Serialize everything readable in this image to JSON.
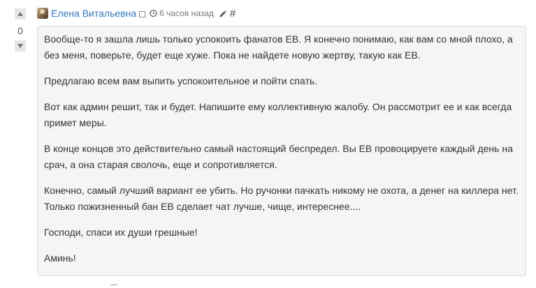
{
  "vote": {
    "count": "0"
  },
  "header": {
    "author": "Елена Витальевна",
    "time": "6 часов назад",
    "hash": "#"
  },
  "body": {
    "paragraphs": [
      "Вообще-то я зашла лишь только успокоить фанатов ЕВ. Я конечно понимаю, как вам со мной плохо, а без меня, поверьте, будет еще хуже. Пока не найдете новую жертву, такую как ЕВ.",
      "Предлагаю всем вам выпить успокоительное и пойти спать.",
      "Вот как админ решит, так и будет. Напишите ему коллективную жалобу. Он рассмотрит ее и как всегда примет меры.",
      "В конце концов это действительно самый настоящий беспредел. Вы ЕВ провоцируете каждый день на срач, а она старая сволочь, еще и сопротивляется.",
      "Конечно, самый лучший вариант ее убить. Но ручонки пачкать никому не охота, а денег на киллера нет. Только пожизненный бан ЕВ сделает чат лучше, чище, интереснее....",
      "Господи, спаси их души грешные!",
      "Аминь!"
    ]
  }
}
